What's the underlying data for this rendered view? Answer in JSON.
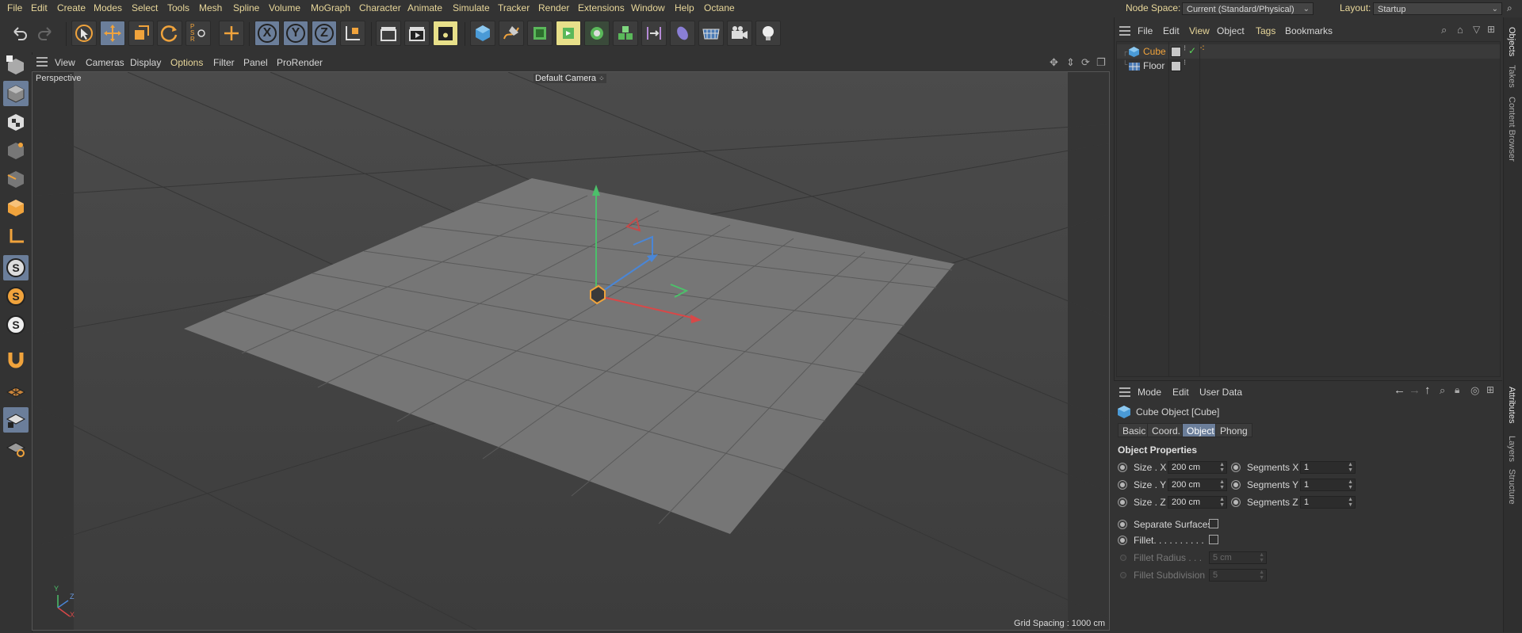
{
  "menubar": {
    "items": [
      "File",
      "Edit",
      "Create",
      "Modes",
      "Select",
      "Tools",
      "Mesh",
      "Spline",
      "Volume",
      "MoGraph",
      "Character",
      "Animate",
      "Simulate",
      "Tracker",
      "Render",
      "Extensions",
      "Window",
      "Help",
      "Octane"
    ],
    "node_space_label": "Node Space:",
    "node_space_value": "Current (Standard/Physical)",
    "layout_label": "Layout:",
    "layout_value": "Startup"
  },
  "toolbar": {
    "axis_x": "X",
    "axis_y": "Y",
    "axis_z": "Z",
    "psr": "PSR"
  },
  "viewport": {
    "menu": [
      "View",
      "Cameras",
      "Display",
      "Options",
      "Filter",
      "Panel",
      "ProRender"
    ],
    "view_name": "Perspective",
    "camera_name": "Default Camera",
    "grid_spacing": "Grid Spacing : 1000 cm",
    "axis_x": "X",
    "axis_y": "Y",
    "axis_z": "Z"
  },
  "objects_panel": {
    "menu": [
      "File",
      "Edit",
      "View",
      "Object",
      "Tags",
      "Bookmarks"
    ],
    "objects": [
      {
        "name": "Cube",
        "selected": true
      },
      {
        "name": "Floor",
        "selected": false
      }
    ]
  },
  "attributes_panel": {
    "menu": [
      "Mode",
      "Edit",
      "User Data"
    ],
    "object_title": "Cube Object [Cube]",
    "tabs": [
      "Basic",
      "Coord.",
      "Object",
      "Phong"
    ],
    "active_tab": "Object",
    "section_title": "Object Properties",
    "size_x_label": "Size . X",
    "size_x": "200 cm",
    "size_y_label": "Size . Y",
    "size_y": "200 cm",
    "size_z_label": "Size . Z",
    "size_z": "200 cm",
    "seg_x_label": "Segments X",
    "seg_x": "1",
    "seg_y_label": "Segments Y",
    "seg_y": "1",
    "seg_z_label": "Segments Z",
    "seg_z": "1",
    "separate_surfaces": "Separate Surfaces",
    "fillet": "Fillet. . . . . . . . . .",
    "fillet_radius_label": "Fillet Radius . . .",
    "fillet_radius": "5 cm",
    "fillet_subdivision_label": "Fillet Subdivision",
    "fillet_subdivision": "5"
  },
  "side_tabs": {
    "top": [
      "Objects",
      "Takes",
      "Content Browser"
    ],
    "bottom": [
      "Attributes",
      "Layers",
      "Structure"
    ]
  },
  "colors": {
    "menu_text": "#e8d79a",
    "highlight": "#6b7e9a",
    "selected_object": "#f0a33c"
  }
}
